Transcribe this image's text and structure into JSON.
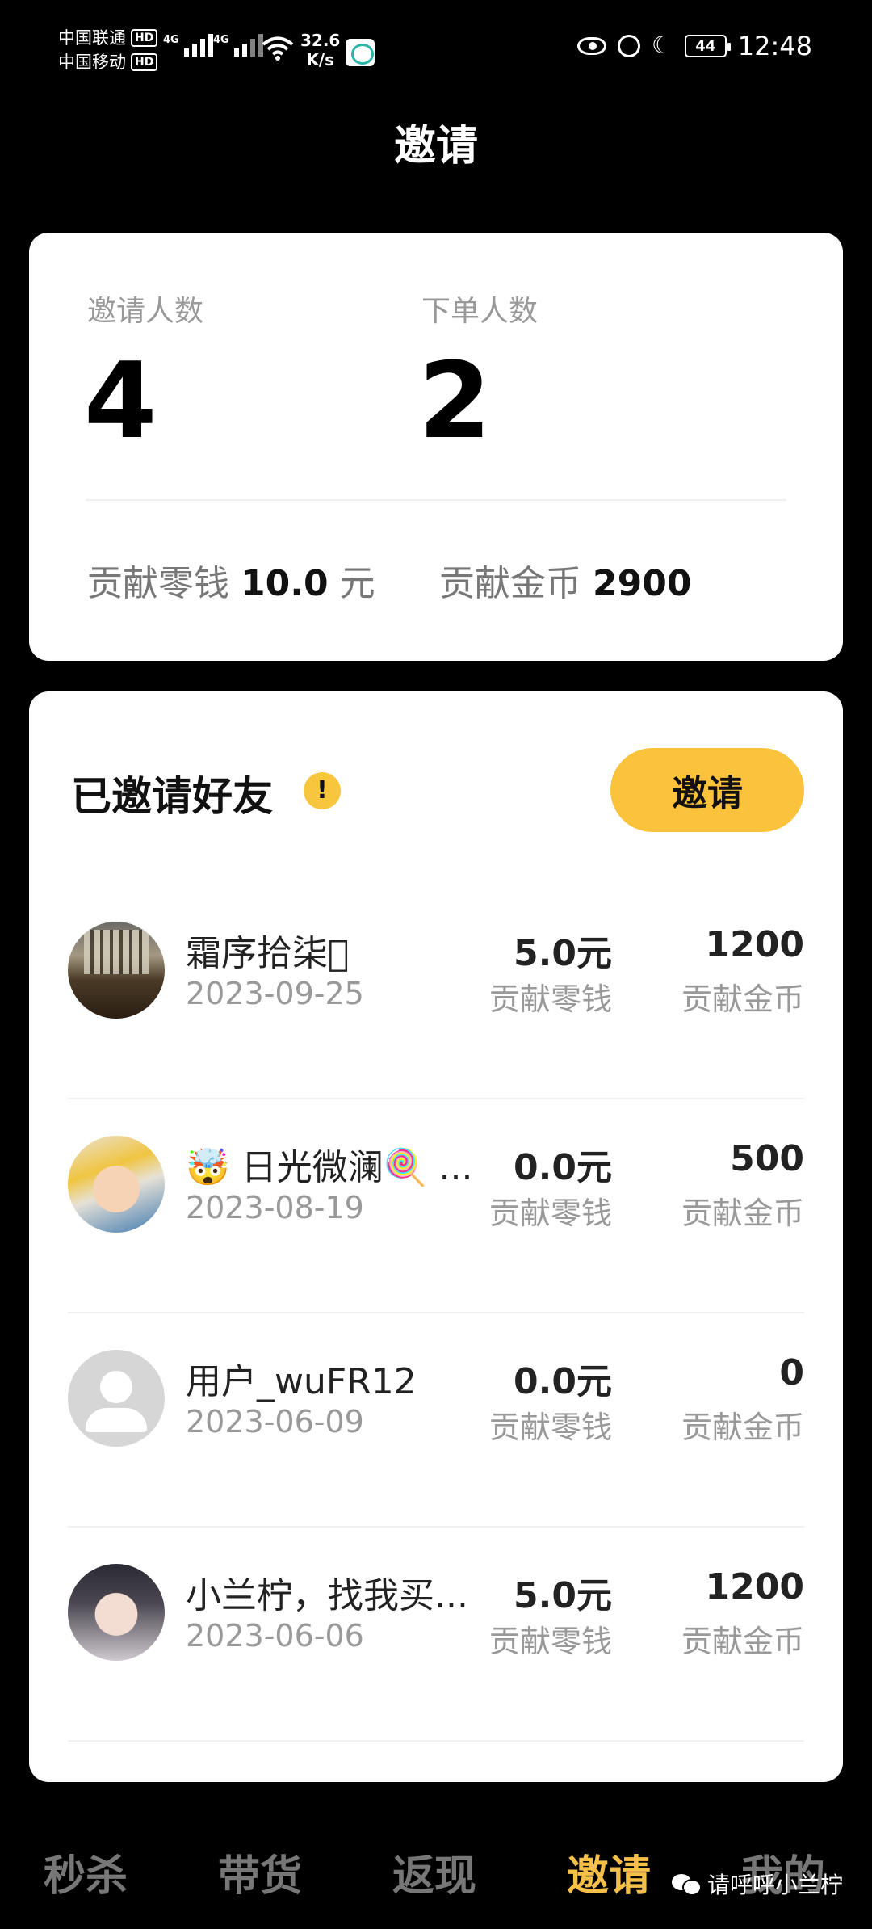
{
  "status_bar": {
    "carrier1": "中国联通",
    "carrier2": "中国移动",
    "hd": "HD",
    "net1": "4G",
    "net2": "4G",
    "speed_value": "32.6",
    "speed_unit": "K/s",
    "battery": "44",
    "time": "12:48"
  },
  "header": {
    "title": "邀请"
  },
  "summary": {
    "invited_label": "邀请人数",
    "invited_value": "4",
    "ordered_label": "下单人数",
    "ordered_value": "2",
    "change_label": "贡献零钱",
    "change_value": "10.0",
    "change_unit": "元",
    "coins_label": "贡献金币",
    "coins_value": "2900"
  },
  "friends": {
    "title": "已邀请好友",
    "warn_symbol": "!",
    "invite_button": "邀请",
    "amount_label": "贡献零钱",
    "coins_label": "贡献金币",
    "list": [
      {
        "name": "霜序拾柒􀀀",
        "date": "2023-09-25",
        "amount": "5.0元",
        "coins": "1200",
        "avatar": "photo-building"
      },
      {
        "name": "🤯 日光微澜🍭 ...",
        "date": "2023-08-19",
        "amount": "0.0元",
        "coins": "500",
        "avatar": "photo-child"
      },
      {
        "name": "用户_wuFR12",
        "date": "2023-06-09",
        "amount": "0.0元",
        "coins": "0",
        "avatar": "default-user"
      },
      {
        "name": "小兰柠，找我买...",
        "date": "2023-06-06",
        "amount": "5.0元",
        "coins": "1200",
        "avatar": "photo-girl"
      }
    ]
  },
  "bottom_nav": {
    "tabs": [
      "秒杀",
      "带货",
      "返现",
      "邀请",
      "我的"
    ],
    "active": "邀请",
    "active_color": "#f4c04a"
  },
  "watermark": {
    "text": "请呼呼小兰柠",
    "icon": "wechat-icon"
  },
  "colors": {
    "accent": "#fbc33c",
    "background": "#000000",
    "card": "#ffffff"
  }
}
